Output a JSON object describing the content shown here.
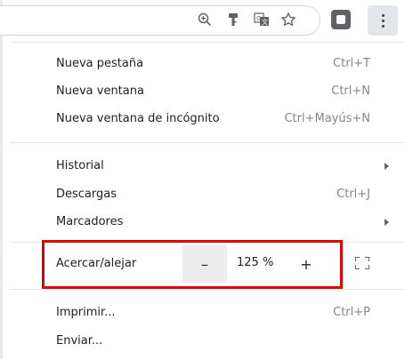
{
  "toolbar": {
    "icons": [
      "zoom-icon",
      "key-icon",
      "translate-icon",
      "star-icon",
      "extension-icon",
      "more-vert-icon"
    ],
    "glyphs": {
      "zoom": "⊕",
      "key": "🔑",
      "translate": "G",
      "star": "☆"
    }
  },
  "menu": {
    "new_tab": {
      "label": "Nueva pestaña",
      "shortcut": "Ctrl+T"
    },
    "new_window": {
      "label": "Nueva ventana",
      "shortcut": "Ctrl+N"
    },
    "incognito": {
      "label": "Nueva ventana de incógnito",
      "shortcut": "Ctrl+Mayús+N"
    },
    "history": {
      "label": "Historial"
    },
    "downloads": {
      "label": "Descargas",
      "shortcut": "Ctrl+J"
    },
    "bookmarks": {
      "label": "Marcadores"
    },
    "zoom": {
      "label": "Acercar/alejar",
      "minus": "–",
      "value": "125 %",
      "plus": "+"
    },
    "print": {
      "label": "Imprimir...",
      "shortcut": "Ctrl+P"
    },
    "send": {
      "label": "Enviar..."
    }
  },
  "colors": {
    "highlight": "#e00000",
    "accent_bg": "#ececed"
  }
}
